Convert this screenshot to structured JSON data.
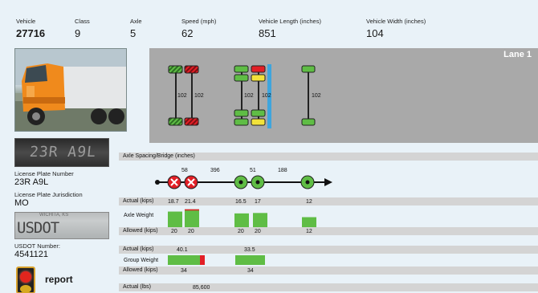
{
  "header": {
    "vehicle": {
      "label": "Vehicle",
      "value": "27716"
    },
    "class": {
      "label": "Class",
      "value": "9"
    },
    "axle": {
      "label": "Axle",
      "value": "5"
    },
    "speed": {
      "label": "Speed (mph)",
      "value": "62"
    },
    "length": {
      "label": "Vehicle Length (inches)",
      "value": "851"
    },
    "width": {
      "label": "Vehicle Width (inches)",
      "value": "104"
    }
  },
  "left": {
    "plate_photo_text": "23R A9L",
    "plate_number_label": "License Plate Number",
    "plate_number": "23R A9L",
    "jurisdiction_label": "License Plate Jurisdiction",
    "jurisdiction": "MO",
    "usdot_photo_top": "WICHITA, KS",
    "usdot_photo_text": "USDOT 4541121",
    "usdot_label": "USDOT Number:",
    "usdot": "4541121",
    "report_label": "report"
  },
  "lane": {
    "label": "Lane 1",
    "widths": [
      "102",
      "102",
      "102",
      "102",
      "102"
    ]
  },
  "spacing": {
    "title": "Axle Spacing/Bridge (inches)",
    "values": [
      "58",
      "396",
      "51",
      "188"
    ]
  },
  "axle_weight": {
    "actual_label": "Actual (kips)",
    "weight_label": "Axle Weight",
    "allowed_label": "Allowed (kips)",
    "actual": [
      "18.7",
      "21.4",
      "16.5",
      "17",
      "12"
    ],
    "allowed": [
      "20",
      "20",
      "20",
      "20",
      "12"
    ],
    "actual_values": [
      18.7,
      21.4,
      16.5,
      17,
      12
    ],
    "allowed_values": [
      20,
      20,
      20,
      20,
      12
    ]
  },
  "group_weight": {
    "actual_label": "Actual (kips)",
    "weight_label": "Group Weight",
    "allowed_label": "Allowed (kips)",
    "actual": [
      "40.1",
      "33.5"
    ],
    "allowed": [
      "34",
      "34"
    ]
  },
  "gross": {
    "actual_label": "Actual (lbs)",
    "actual": "85,600"
  },
  "colors": {
    "ok": "#5fbd45",
    "over": "#e21f26",
    "warn": "#f2e23a",
    "sensor": "#3ea5dd"
  }
}
